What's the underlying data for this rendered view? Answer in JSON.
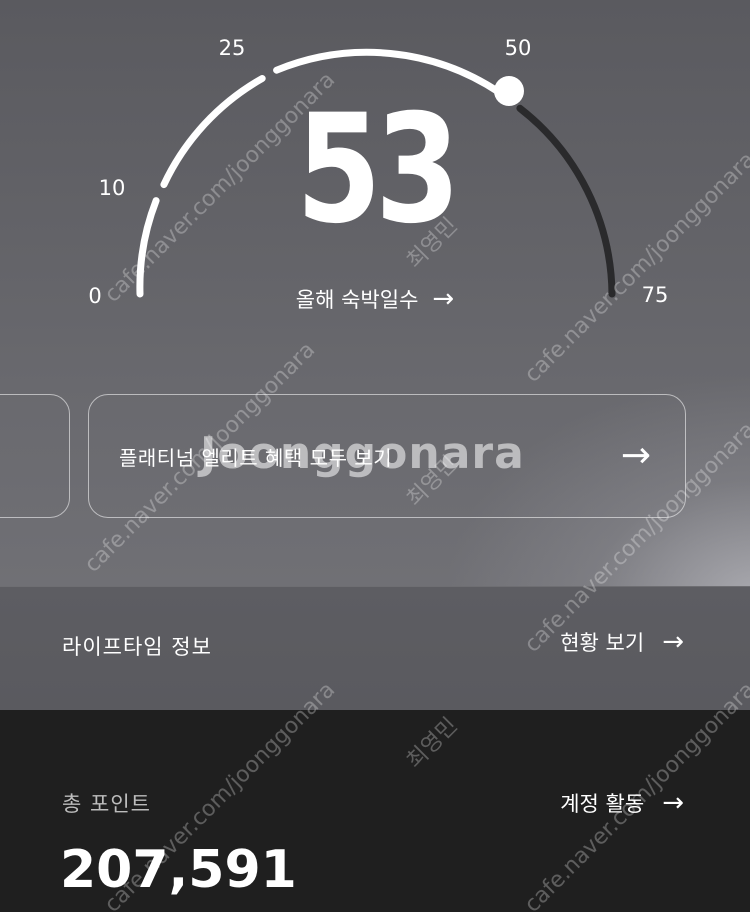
{
  "gauge": {
    "value": "53",
    "value_number": 53,
    "min": 0,
    "max": 75,
    "ticks": [
      "0",
      "10",
      "25",
      "50",
      "75"
    ],
    "link_label": "올해 숙박일수"
  },
  "cards": {
    "main_label": "플래티넘 엘리트 혜택 모두 보기"
  },
  "lifetime": {
    "title": "라이프타임 정보",
    "link_label": "현황 보기"
  },
  "points": {
    "title": "총 포인트",
    "link_label": "계정 활동",
    "value": "207,591"
  },
  "watermark": {
    "logo_text": "Joonggonara",
    "url_text": "cafe.naver.com/joonggonara",
    "name_text": "최영민"
  },
  "icons": {
    "arrow": "→"
  }
}
